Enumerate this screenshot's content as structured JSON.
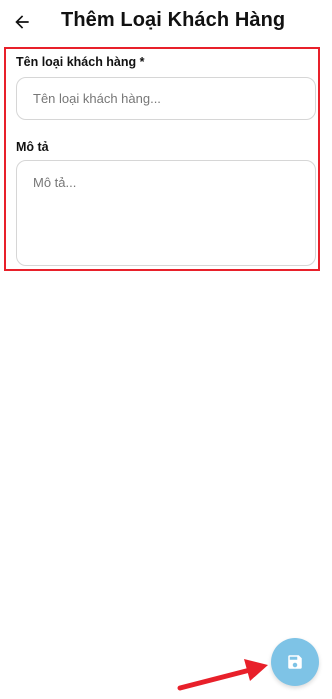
{
  "header": {
    "title": "Thêm Loại Khách Hàng",
    "back_icon": "arrow-left-icon"
  },
  "form": {
    "name_label": "Tên loại khách hàng *",
    "name_placeholder": "Tên loại khách hàng...",
    "description_label": "Mô tả",
    "description_placeholder": "Mô tả..."
  },
  "fab": {
    "icon": "save-icon",
    "color": "#7ec3e6"
  },
  "annotation": {
    "highlight_color": "#e8202a",
    "arrow_color": "#e8202a"
  }
}
